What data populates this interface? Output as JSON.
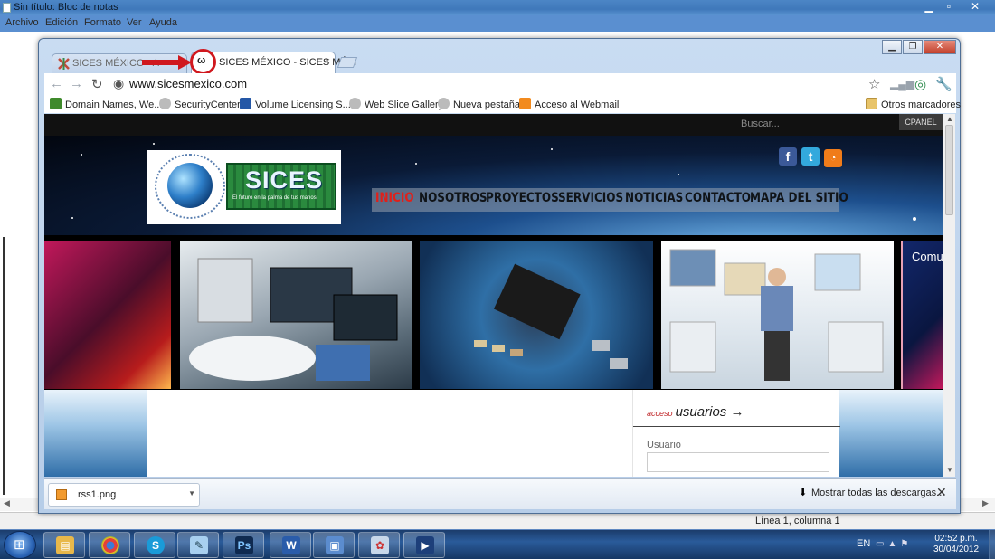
{
  "notepad": {
    "title": "Sin título: Bloc de notas",
    "menu": [
      "Archivo",
      "Edición",
      "Formato",
      "Ver",
      "Ayuda"
    ],
    "status": "Línea 1, columna 1"
  },
  "browser": {
    "tabs": [
      {
        "label": "SICES MÉXICO - A",
        "active": false
      },
      {
        "label": "SICES MÉXICO - SICES MÉXI",
        "active": true
      }
    ],
    "url": "www.sicesmexico.com",
    "bookmarks": [
      {
        "label": "Domain Names, We...",
        "icon": "ns-icon"
      },
      {
        "label": "SecurityCenter",
        "icon": "security-icon"
      },
      {
        "label": "Volume Licensing S...",
        "icon": "ms-icon"
      },
      {
        "label": "Web Slice Gallery",
        "icon": "slice-icon"
      },
      {
        "label": "Nueva pestaña",
        "icon": "globe-icon"
      },
      {
        "label": "Acceso al Webmail",
        "icon": "cpanel-icon"
      }
    ],
    "other_bookmarks": "Otros marcadores",
    "downloads": {
      "file": "rss1.png",
      "show_all": "Mostrar todas las descargas..."
    }
  },
  "site": {
    "search_placeholder": "Buscar...",
    "cpanel": "CPANEL",
    "logo_text": "SICES",
    "logo_tagline": "El futuro en la palma de tus manos",
    "nav": [
      "INICIO",
      "NOSOTROS",
      "PROYECTOS",
      "SERVICIOS",
      "NOTICIAS",
      "CONTACTO",
      "MAPA DEL SITIO"
    ],
    "active_nav": "INICIO",
    "slide_caption": "Comu",
    "login": {
      "prefix": "acceso",
      "title": "usuarios →",
      "username_label": "Usuario"
    }
  },
  "taskbar": {
    "lang": "EN",
    "time": "02:52 p.m.",
    "date": "30/04/2012",
    "apps": [
      "explorer",
      "chrome",
      "skype",
      "notepad",
      "photoshop",
      "word",
      "rdp",
      "paint",
      "media"
    ]
  },
  "colors": {
    "nav_active": "#e0201a",
    "accent_red": "#d0181e",
    "taskbar": "#2a5b9a"
  }
}
